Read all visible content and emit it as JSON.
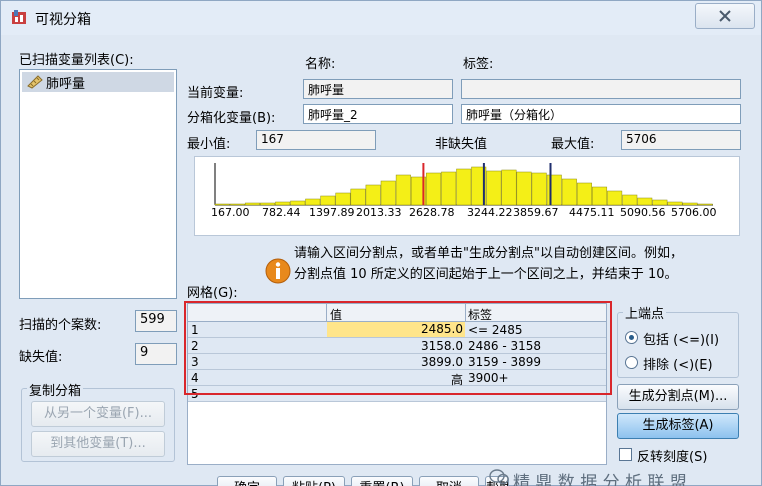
{
  "window": {
    "title": "可视分箱",
    "close_icon": "close-icon"
  },
  "scanned_list": {
    "label": "已扫描变量列表(C):",
    "items": [
      {
        "label": "肺呼量",
        "icon": "ruler-icon"
      }
    ]
  },
  "variable": {
    "name_header": "名称:",
    "label_header": "标签:",
    "current_label": "当前变量:",
    "current_name": "肺呼量",
    "current_value_label": "",
    "binned_label": "分箱化变量(B):",
    "binned_name": "肺呼量_2",
    "binned_value_label": "肺呼量（分箱化）"
  },
  "stats": {
    "min_label": "最小值:",
    "min_value": "167",
    "nonmissing_label": "非缺失值",
    "max_label": "最大值:",
    "max_value": "5706"
  },
  "histogram": {
    "ticks": [
      "167.00",
      "782.44",
      "1397.89",
      "2013.33",
      "2628.78",
      "3244.22",
      "3859.67",
      "4475.11",
      "5090.56",
      "5706.00"
    ]
  },
  "info": {
    "line1": "请输入区间分割点，或者单击\"生成分割点\"以自动创建区间。例如，",
    "line2": "分割点值 10 所定义的区间起始于上一个区间之上，并结束于 10。",
    "icon": "info-icon"
  },
  "grid": {
    "label": "网格(G):",
    "headers": [
      "",
      "值",
      "标签"
    ],
    "rows": [
      {
        "index": "1",
        "value": "2485.0",
        "label": "<= 2485"
      },
      {
        "index": "2",
        "value": "3158.0",
        "label": "2486 - 3158"
      },
      {
        "index": "3",
        "value": "3899.0",
        "label": "3159 - 3899"
      },
      {
        "index": "4",
        "value": "高",
        "label": "3900+"
      },
      {
        "index": "5",
        "value": "",
        "label": ""
      }
    ]
  },
  "cases": {
    "scanned_label": "扫描的个案数:",
    "scanned_value": "599",
    "missing_label": "缺失值:",
    "missing_value": "9"
  },
  "copy_bins": {
    "title": "复制分箱",
    "from_button": "从另一个变量(F)...",
    "to_button": "到其他变量(T)..."
  },
  "upper": {
    "title": "上端点",
    "include": "包括 (<=)(I)",
    "exclude": "排除 (<)(E)"
  },
  "actions": {
    "make_cutpoints": "生成分割点(M)...",
    "make_labels": "生成标签(A)",
    "reverse_scale": "反转刻度(S)"
  },
  "footer": {
    "ok": "确定",
    "paste": "粘贴(P)",
    "reset": "重置(R)",
    "cancel": "取消",
    "help": "帮助"
  },
  "watermark": "精 鼎 数 据 分 析 联 盟",
  "colors": {
    "bar_fill": "#f4ef17",
    "cut_line": "#1f2e6e",
    "current_line": "#d9262b",
    "highlight": "#ffe58a"
  }
}
